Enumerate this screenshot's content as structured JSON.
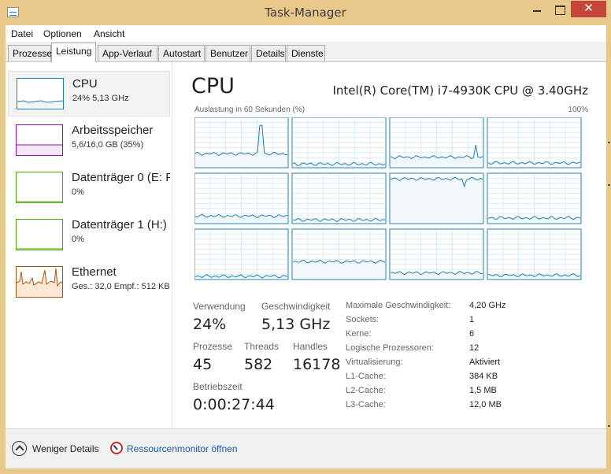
{
  "window": {
    "title": "Task-Manager",
    "close_glyph": "✕"
  },
  "menu": [
    "Datei",
    "Optionen",
    "Ansicht"
  ],
  "tabs": [
    "Prozesse",
    "Leistung",
    "App-Verlauf",
    "Autostart",
    "Benutzer",
    "Details",
    "Dienste"
  ],
  "active_tab": "Leistung",
  "sidebar": [
    {
      "title": "CPU",
      "sub": "24%  5,13 GHz",
      "color": "#1f7fb4",
      "selected": true
    },
    {
      "title": "Arbeitsspeicher",
      "sub": "5,6/16,0 GB (35%)",
      "color": "#8b12ae",
      "selected": false
    },
    {
      "title": "Datenträger 0 (E: F",
      "sub": "0%",
      "color": "#4da60c",
      "selected": false
    },
    {
      "title": "Datenträger 1 (H:)",
      "sub": "0%",
      "color": "#4da60c",
      "selected": false
    },
    {
      "title": "Ethernet",
      "sub": "Ges.: 32,0  Empf.: 512 KB",
      "color": "#a7530e",
      "selected": false
    }
  ],
  "cpu": {
    "title": "CPU",
    "model": "Intel(R) Core(TM) i7-4930K CPU @ 3.40GHz",
    "graph_label": "Auslastung in 60 Sekunden (%)",
    "graph_max": "100%",
    "line_color": "#1f7fb4",
    "fill_color": "#f1f6fa",
    "grid_color": "#d9eaf4",
    "stats": {
      "usage_label": "Verwendung",
      "usage_value": "24%",
      "speed_label": "Geschwindigkeit",
      "speed_value": "5,13 GHz",
      "processes_label": "Prozesse",
      "processes_value": "45",
      "threads_label": "Threads",
      "threads_value": "582",
      "handles_label": "Handles",
      "handles_value": "16178",
      "uptime_label": "Betriebszeit",
      "uptime_value": "0:00:27:44"
    },
    "details": [
      {
        "key": "Maximale Geschwindigkeit:",
        "value": "4,20 GHz"
      },
      {
        "key": "Sockets:",
        "value": "1"
      },
      {
        "key": "Kerne:",
        "value": "6"
      },
      {
        "key": "Logische Prozessoren:",
        "value": "12"
      },
      {
        "key": "Virtualisierung:",
        "value": "Aktiviert"
      },
      {
        "key": "L1-Cache:",
        "value": "384 KB"
      },
      {
        "key": "L2-Cache:",
        "value": "1,5 MB"
      },
      {
        "key": "L3-Cache:",
        "value": "12,0 MB"
      }
    ],
    "core_levels": [
      27,
      6,
      20,
      8,
      14,
      6,
      90,
      10,
      5,
      35,
      12,
      7
    ]
  },
  "footer": {
    "less_details": "Weniger Details",
    "resmon": "Ressourcenmonitor öffnen"
  }
}
